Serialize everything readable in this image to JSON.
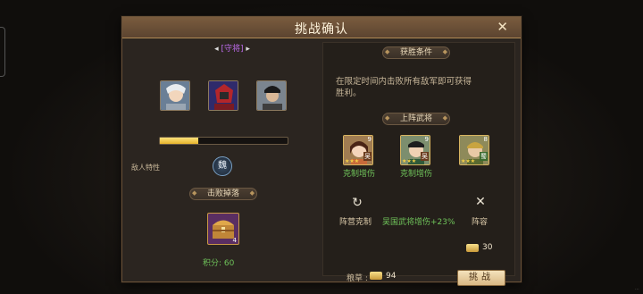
{
  "dialog": {
    "title": "挑战确认",
    "close_label": "✕"
  },
  "left": {
    "mode_label": "[守将]",
    "enemy_trait_label": "敌人特性",
    "trait_icon_text": "魏",
    "drop_title": "击败掉落",
    "drop_item_count": "4",
    "score_label": "积分: 60",
    "progress": 0.3
  },
  "right": {
    "victory_title": "获胜条件",
    "victory_text_line1": "在限定时间内击败所有敌军即可获得",
    "victory_text_line2": "胜利。",
    "generals_title": "上阵武将",
    "generals": [
      {
        "name_tag": "克制增伤",
        "level": "9",
        "faction": "吴"
      },
      {
        "name_tag": "克制增伤",
        "level": "9",
        "faction": "吴"
      },
      {
        "name_tag": "",
        "level": "8",
        "faction": "蜀"
      }
    ],
    "faction_counter_label": "阵营克制",
    "faction_bonus_text": "吴国武将增伤+23%",
    "lineup_label": "阵容",
    "grain_label": "粮草 :",
    "grain_value": "94",
    "cost_value": "30",
    "challenge_label": "挑战"
  },
  "colors": {
    "accent": "#f4cf46",
    "green": "#6fc35a",
    "title_bar": "#6b4f36"
  }
}
